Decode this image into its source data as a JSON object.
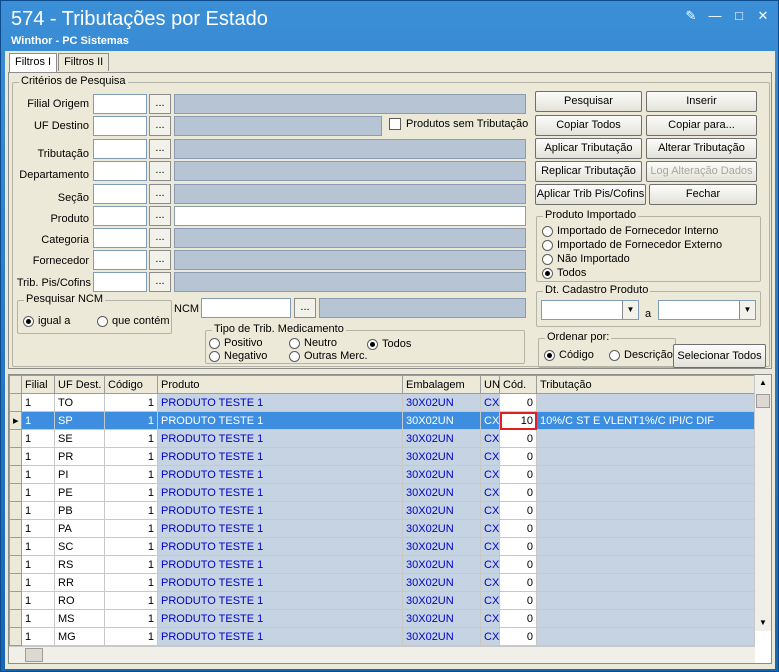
{
  "window": {
    "title": "574 - Tributações por Estado",
    "subtitle": "Winthor - PC Sistemas"
  },
  "tabs": [
    "Filtros I",
    "Filtros II"
  ],
  "criteria": {
    "group_label": "Critérios de Pesquisa",
    "fields": {
      "filial_origem": "Filial Origem",
      "uf_destino": "UF Destino",
      "tributacao": "Tributação",
      "departamento": "Departamento",
      "secao": "Seção",
      "produto": "Produto",
      "categoria": "Categoria",
      "fornecedor": "Fornecedor",
      "trib_pis_cofins": "Trib. Pis/Cofins"
    },
    "ellipsis": "...",
    "produtos_sem_tributacao": "Produtos sem Tributação",
    "pesquisar_ncm": {
      "label": "Pesquisar NCM",
      "igual_a": "igual a",
      "que_contem": "que contém"
    },
    "ncm_label": "NCM"
  },
  "tipo_trib": {
    "label": "Tipo de Trib. Medicamento",
    "positivo": "Positivo",
    "negativo": "Negativo",
    "neutro": "Neutro",
    "outras": "Outras Merc.",
    "todos": "Todos"
  },
  "buttons": {
    "pesquisar": "Pesquisar",
    "inserir": "Inserir",
    "copiar_todos": "Copiar Todos",
    "copiar_para": "Copiar para...",
    "aplicar_tributacao": "Aplicar Tributação",
    "alterar_tributacao": "Alterar Tributação",
    "replicar_tributacao": "Replicar Tributação",
    "log_alteracao": "Log Alteração Dados",
    "aplicar_trib_pis": "Aplicar Trib Pis/Cofins",
    "fechar": "Fechar",
    "selecionar_todos": "Selecionar Todos"
  },
  "produto_importado": {
    "label": "Produto Importado",
    "opt1": "Importado de Fornecedor Interno",
    "opt2": "Importado de Fornecedor Externo",
    "opt3": "Não Importado",
    "opt4": "Todos"
  },
  "dt_cadastro": {
    "label": "Dt. Cadastro Produto",
    "a": "a"
  },
  "ordenar": {
    "label": "Ordenar por:",
    "codigo": "Código",
    "descricao": "Descrição"
  },
  "grid": {
    "columns": [
      "Filial",
      "UF Dest.",
      "Código",
      "Produto",
      "Embalagem",
      "UN",
      "Cód.",
      "Tributação"
    ],
    "rows": [
      [
        "1",
        "TO",
        "1",
        "PRODUTO TESTE 1",
        "30X02UN",
        "CX",
        "0",
        ""
      ],
      [
        "1",
        "SP",
        "1",
        "PRODUTO TESTE 1",
        "30X02UN",
        "CX",
        "10",
        "10%/C ST E VLENT1%/C IPI/C DIF"
      ],
      [
        "1",
        "SE",
        "1",
        "PRODUTO TESTE 1",
        "30X02UN",
        "CX",
        "0",
        ""
      ],
      [
        "1",
        "PR",
        "1",
        "PRODUTO TESTE 1",
        "30X02UN",
        "CX",
        "0",
        ""
      ],
      [
        "1",
        "PI",
        "1",
        "PRODUTO TESTE 1",
        "30X02UN",
        "CX",
        "0",
        ""
      ],
      [
        "1",
        "PE",
        "1",
        "PRODUTO TESTE 1",
        "30X02UN",
        "CX",
        "0",
        ""
      ],
      [
        "1",
        "PB",
        "1",
        "PRODUTO TESTE 1",
        "30X02UN",
        "CX",
        "0",
        ""
      ],
      [
        "1",
        "PA",
        "1",
        "PRODUTO TESTE 1",
        "30X02UN",
        "CX",
        "0",
        ""
      ],
      [
        "1",
        "SC",
        "1",
        "PRODUTO TESTE 1",
        "30X02UN",
        "CX",
        "0",
        ""
      ],
      [
        "1",
        "RS",
        "1",
        "PRODUTO TESTE 1",
        "30X02UN",
        "CX",
        "0",
        ""
      ],
      [
        "1",
        "RR",
        "1",
        "PRODUTO TESTE 1",
        "30X02UN",
        "CX",
        "0",
        ""
      ],
      [
        "1",
        "RO",
        "1",
        "PRODUTO TESTE 1",
        "30X02UN",
        "CX",
        "0",
        ""
      ],
      [
        "1",
        "MS",
        "1",
        "PRODUTO TESTE 1",
        "30X02UN",
        "CX",
        "0",
        ""
      ],
      [
        "1",
        "MG",
        "1",
        "PRODUTO TESTE 1",
        "30X02UN",
        "CX",
        "0",
        ""
      ]
    ],
    "selected_row": 1
  }
}
